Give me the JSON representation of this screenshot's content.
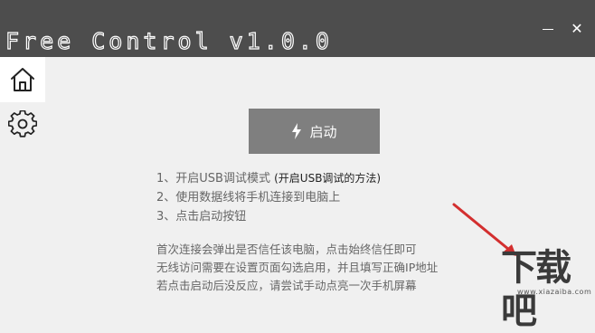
{
  "window": {
    "title": "Free Control v1.0.0",
    "minimize_symbol": "—",
    "close_symbol": "✕"
  },
  "sidebar": {
    "items": [
      {
        "icon": "home-icon",
        "active": true
      },
      {
        "icon": "gear-icon",
        "active": false
      }
    ]
  },
  "main": {
    "start_button": {
      "icon": "lightning-icon",
      "label": "启动"
    },
    "steps": [
      {
        "text": "1、开启USB调试模式",
        "link": "(开启USB调试的方法)"
      },
      {
        "text": "2、使用数据线将手机连接到电脑上"
      },
      {
        "text": "3、点击启动按钮"
      }
    ],
    "notes": [
      "首次连接会弹出是否信任该电脑，点击始终信任即可",
      "无线访问需要在设置页面勾选启用，并且填写正确IP地址",
      "若点击启动后没反应，请尝试手动点亮一次手机屏幕"
    ]
  },
  "watermark": {
    "big": "下载吧",
    "url": "www.xiazaiba.com"
  },
  "colors": {
    "titlebar": "#4d4d4d",
    "button": "#7f7f7f",
    "arrow": "#d32f2f"
  }
}
